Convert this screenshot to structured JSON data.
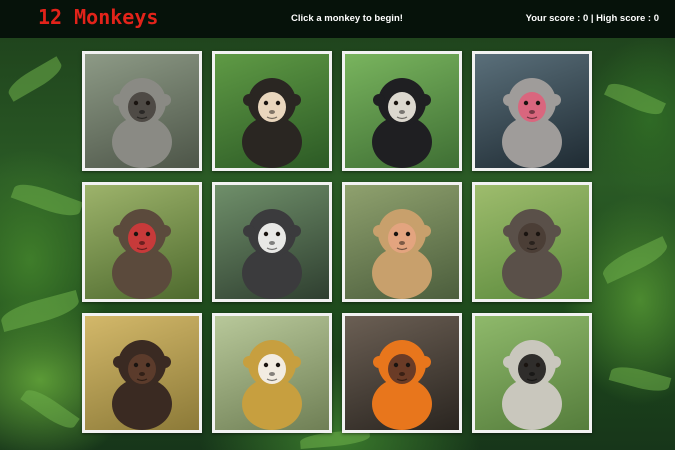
{
  "header": {
    "title": "12 Monkeys",
    "instructions": "Click a monkey to begin!",
    "score_text": "Your score : 0 | High score : 0"
  },
  "colors": {
    "title_red": "#e2231a",
    "header_bg": "#06120a",
    "card_border": "#f2f2f2"
  },
  "cards": [
    {
      "icon": "vervet-monkey-closeup-icon",
      "bg": [
        "#8d9a86",
        "#4d5548"
      ],
      "fur": "#8a8a84",
      "face": "#4e4a45"
    },
    {
      "icon": "capuchin-monkey-icon",
      "bg": [
        "#5f9a45",
        "#2c5a25"
      ],
      "fur": "#2a2622",
      "face": "#e9d6bd"
    },
    {
      "icon": "gibbon-icon",
      "bg": [
        "#79b45e",
        "#3f6f34"
      ],
      "fur": "#1f1f22",
      "face": "#dcd8cf"
    },
    {
      "icon": "japanese-macaque-icon",
      "bg": [
        "#5a6f7a",
        "#1f2b33"
      ],
      "fur": "#9f9c9a",
      "face": "#d9667e"
    },
    {
      "icon": "mandrill-icon",
      "bg": [
        "#9db36b",
        "#4e6a2e"
      ],
      "fur": "#5b4a3c",
      "face": "#c73a3a"
    },
    {
      "icon": "marmoset-icon",
      "bg": [
        "#6f8f6a",
        "#2f3f30"
      ],
      "fur": "#3b3b3d",
      "face": "#e8e8e6"
    },
    {
      "icon": "proboscis-monkey-icon",
      "bg": [
        "#8fa16e",
        "#4c5e3d"
      ],
      "fur": "#c8a06c",
      "face": "#e3a47f"
    },
    {
      "icon": "macaque-on-grass-icon",
      "bg": [
        "#9ebc6d",
        "#5b8a3c"
      ],
      "fur": "#5a5049",
      "face": "#4b3e36"
    },
    {
      "icon": "spider-monkey-icon",
      "bg": [
        "#d3b86a",
        "#8c7a38"
      ],
      "fur": "#3a2a22",
      "face": "#5b3b2b"
    },
    {
      "icon": "squirrel-monkey-icon",
      "bg": [
        "#b8c89a",
        "#6f7f55"
      ],
      "fur": "#c79f3f",
      "face": "#f2ece1"
    },
    {
      "icon": "golden-lion-tamarin-icon",
      "bg": [
        "#6b5f54",
        "#2a2520"
      ],
      "fur": "#e8761c",
      "face": "#6a3b26"
    },
    {
      "icon": "vervet-monkey-icon",
      "bg": [
        "#8fb96b",
        "#557d3c"
      ],
      "fur": "#c9c7bd",
      "face": "#2f2d2b"
    }
  ]
}
